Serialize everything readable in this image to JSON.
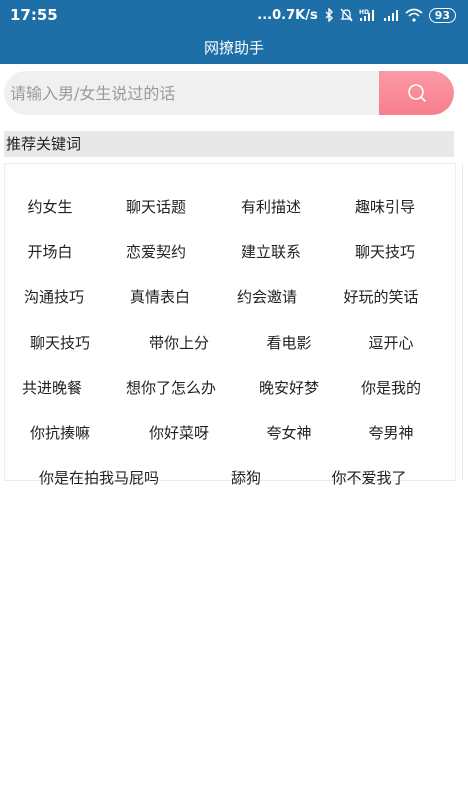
{
  "status_bar": {
    "time": "17:55",
    "network_speed": "...0.7K/s",
    "battery": "93",
    "icons": [
      "bluetooth-icon",
      "mute-icon",
      "hd-signal-icon",
      "signal-icon",
      "wifi-icon",
      "battery-icon"
    ]
  },
  "app": {
    "title": "网撩助手"
  },
  "search": {
    "placeholder": "请输入男/女生说过的话",
    "button_icon": "search-icon",
    "button_color": "#f77e8c"
  },
  "section": {
    "title": "推荐关键词"
  },
  "keywords": {
    "row1": [
      "约女生",
      "聊天话题",
      "有利描述",
      "趣味引导"
    ],
    "row2": [
      "开场白",
      "恋爱契约",
      "建立联系",
      "聊天技巧"
    ],
    "row3": [
      "沟通技巧",
      "真情表白",
      "约会邀请",
      "好玩的笑话"
    ],
    "row4": [
      "聊天技巧",
      "带你上分",
      "看电影",
      "逗开心"
    ],
    "row5": [
      "共进晚餐",
      "想你了怎么办",
      "晚安好梦",
      "你是我的"
    ],
    "row6": [
      "你抗揍嘛",
      "你好菜呀",
      "夸女神",
      "夸男神"
    ],
    "row7": [
      "你是在拍我马屁吗",
      "舔狗",
      "你不爱我了"
    ]
  },
  "colors": {
    "header_bg": "#1e6fa8",
    "search_bg": "#f0f0f0",
    "section_bg": "#e8e8e8"
  }
}
